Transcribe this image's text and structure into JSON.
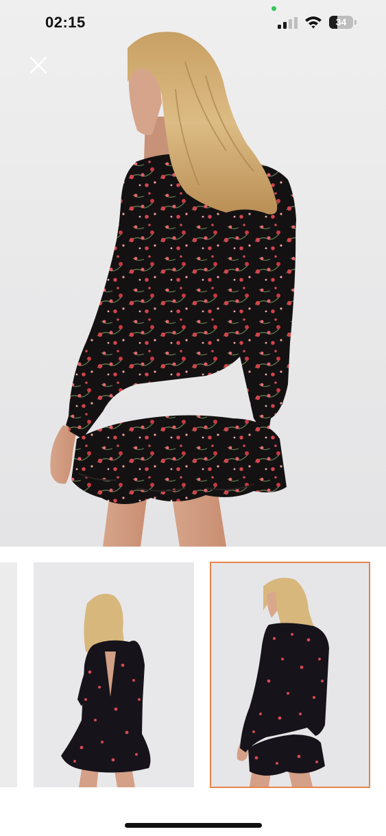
{
  "status_bar": {
    "time": "02:15",
    "battery": "34",
    "battery_level": 0.34,
    "icons": [
      "signal-icon",
      "wifi-icon",
      "battery-icon"
    ]
  },
  "viewer": {
    "close_icon": "close-icon",
    "selected_thumbnail": 2
  },
  "thumbnails": [
    {
      "name": "product-image-previous"
    },
    {
      "name": "product-image-front"
    },
    {
      "name": "product-image-back"
    }
  ],
  "colors": {
    "selected_border": "#e8844a",
    "dress": "#141112",
    "flower": "#d2454c"
  }
}
